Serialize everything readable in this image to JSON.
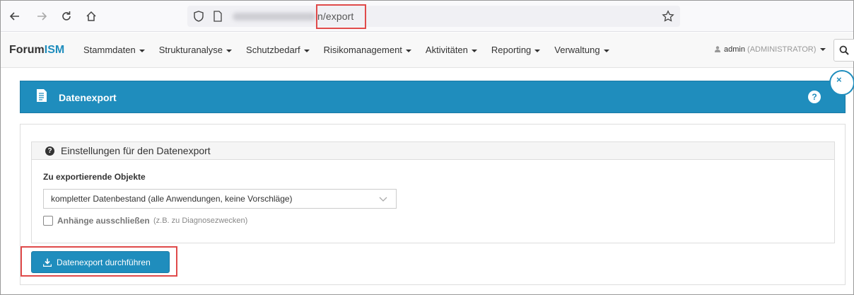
{
  "browser": {
    "url_suffix": "n/export",
    "icons": [
      "back-icon",
      "forward-icon",
      "reload-icon",
      "home-icon",
      "shield-icon",
      "page-icon",
      "star-icon"
    ]
  },
  "navbar": {
    "brand_prefix": "Forum",
    "brand_suffix": "ISM",
    "menu": [
      {
        "label": "Stammdaten"
      },
      {
        "label": "Strukturanalyse"
      },
      {
        "label": "Schutzbedarf"
      },
      {
        "label": "Risikomanagement"
      },
      {
        "label": "Aktivitäten"
      },
      {
        "label": "Reporting"
      },
      {
        "label": "Verwaltung"
      }
    ],
    "user_name": "admin",
    "user_role": "(ADMINISTRATOR)"
  },
  "header": {
    "title": "Datenexport",
    "help": "?",
    "close": "×"
  },
  "settings": {
    "heading": "Einstellungen für den Datenexport",
    "field_label": "Zu exportierende Objekte",
    "select_value": "kompletter Datenbestand (alle Anwendungen, keine Vorschläge)",
    "checkbox_label": "Anhänge ausschließen",
    "checkbox_hint": "(z.B. zu Diagnosezwecken)",
    "checkbox_checked": false
  },
  "actions": {
    "export_label": "Datenexport durchführen"
  },
  "colors": {
    "accent": "#1f8dbd",
    "highlight": "#e04a4a"
  }
}
